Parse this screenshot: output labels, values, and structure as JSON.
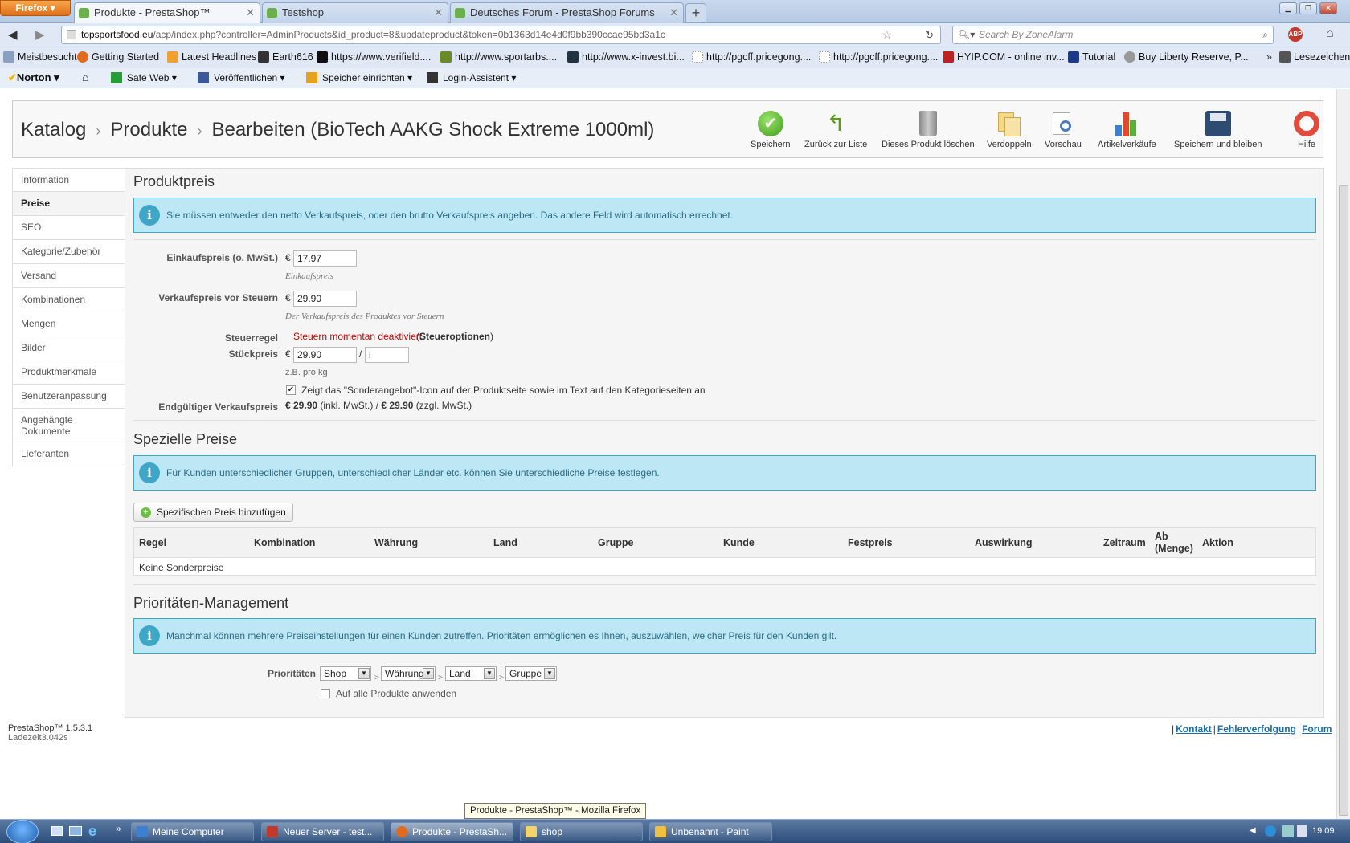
{
  "browser": {
    "menu_button": "Firefox",
    "tabs": [
      {
        "title": "Produkte - PrestaShop™",
        "active": true
      },
      {
        "title": "Testshop",
        "active": false
      },
      {
        "title": "Deutsches Forum - PrestaShop Forums",
        "active": false
      }
    ],
    "new_tab": "+",
    "url_host": "topsportsfood.eu",
    "url_path": "/acp/index.php?controller=AdminProducts&id_product=8&updateproduct&token=0b1363d14e4d0f9bb390ccae95bd3a1c",
    "search_placeholder": "Search By ZoneAlarm",
    "bookmarks": [
      "Meistbesucht",
      "Getting Started",
      "Latest Headlines",
      "Earth616",
      "https://www.verifield....",
      "http://www.sportarbs....",
      "http://www.x-invest.bi...",
      "http://pgcff.pricegong....",
      "http://pgcff.pricegong....",
      "HYIP.COM - online inv...",
      "Tutorial",
      "Buy Liberty Reserve, P...",
      "Lesezeichen"
    ],
    "toolbar2": {
      "norton": "Norton",
      "safeweb": "Safe Web",
      "publish": "Veröffentlichen",
      "storage": "Speicher einrichten",
      "login": "Login-Assistent"
    }
  },
  "breadcrumb": {
    "catalog": "Katalog",
    "products": "Produkte",
    "edit": "Bearbeiten (BioTech AAKG Shock Extreme 1000ml)",
    "separator": "›"
  },
  "toolbar": {
    "save": "Speichern",
    "back": "Zurück zur Liste",
    "delete": "Dieses Produkt löschen",
    "duplicate": "Verdoppeln",
    "preview": "Vorschau",
    "sales": "Artikelverkäufe",
    "save_stay": "Speichern und bleiben",
    "help": "Hilfe"
  },
  "sidebar": {
    "items": [
      "Information",
      "Preise",
      "SEO",
      "Kategorie/Zubehör",
      "Versand",
      "Kombinationen",
      "Mengen",
      "Bilder",
      "Produktmerkmale",
      "Benutzeranpassung",
      "Angehängte Dokumente",
      "Lieferanten"
    ],
    "active": "Preise"
  },
  "price": {
    "title": "Produktpreis",
    "info": "Sie müssen entweder den netto Verkaufspreis, oder den brutto Verkaufspreis angeben. Das andere Feld wird automatisch errechnet.",
    "currency": "€",
    "wholesale_label": "Einkaufspreis (o. MwSt.)",
    "wholesale_value": "17.97",
    "wholesale_hint": "Einkaufspreis",
    "pretax_label": "Verkaufspreis vor Steuern",
    "pretax_value": "29.90",
    "pretax_hint": "Der Verkaufspreis des Produktes vor Steuern",
    "tax_label": "Steuerregel",
    "tax_disabled": "Steuern momentan deaktiviert",
    "tax_options": "Steueroptionen",
    "unit_label": "Stückpreis",
    "unit_value": "29.90",
    "unit_slash": "/",
    "unit_unit": "l",
    "unit_hint": "z.B. pro kg",
    "onsale_text": "Zeigt das \"Sonderangebot\"-Icon auf der Produktseite sowie im Text auf den Kategorieseiten an",
    "onsale_checked": true,
    "final_label": "Endgültiger Verkaufspreis",
    "final_incl": "€ 29.90",
    "final_incl_suffix": "(inkl. MwSt.) /",
    "final_excl": "€ 29.90",
    "final_excl_suffix": "(zzgl. MwSt.)"
  },
  "specific": {
    "title": "Spezielle Preise",
    "info": "Für Kunden unterschiedlicher Gruppen, unterschiedlicher Länder etc. können Sie unterschiedliche Preise festlegen.",
    "add_button": "Spezifischen Preis hinzufügen",
    "columns": [
      "Regel",
      "Kombination",
      "Währung",
      "Land",
      "Gruppe",
      "Kunde",
      "Festpreis",
      "Auswirkung",
      "Zeitraum",
      "Ab (Menge)",
      "Aktion"
    ],
    "empty": "Keine Sonderpreise"
  },
  "priority": {
    "title": "Prioritäten-Management",
    "info": "Manchmal können mehrere Preiseinstellungen für einen Kunden zutreffen. Prioritäten ermöglichen es Ihnen, auszuwählen, welcher Preis für den Kunden gilt.",
    "label": "Prioritäten",
    "selects": [
      "Shop",
      "Währung",
      "Land",
      "Gruppe"
    ],
    "apply_all": "Auf alle Produkte anwenden"
  },
  "footer": {
    "version": "PrestaShop™ 1.5.3.1",
    "load": "Ladezeit3.042s",
    "links": [
      "Kontakt",
      "Fehlerverfolgung",
      "Forum"
    ]
  },
  "tooltip": "Produkte - PrestaShop™ - Mozilla Firefox",
  "taskbar": {
    "items": [
      "Meine Computer",
      "Neuer Server - test...",
      "Produkte - PrestaSh...",
      "shop",
      "Unbenannt - Paint"
    ],
    "clock": "19:09"
  },
  "colors": {
    "accent": "#3ea7c8",
    "info_bg": "#bde7f5",
    "danger": "#cc0000",
    "link": "#1a6fa8"
  }
}
